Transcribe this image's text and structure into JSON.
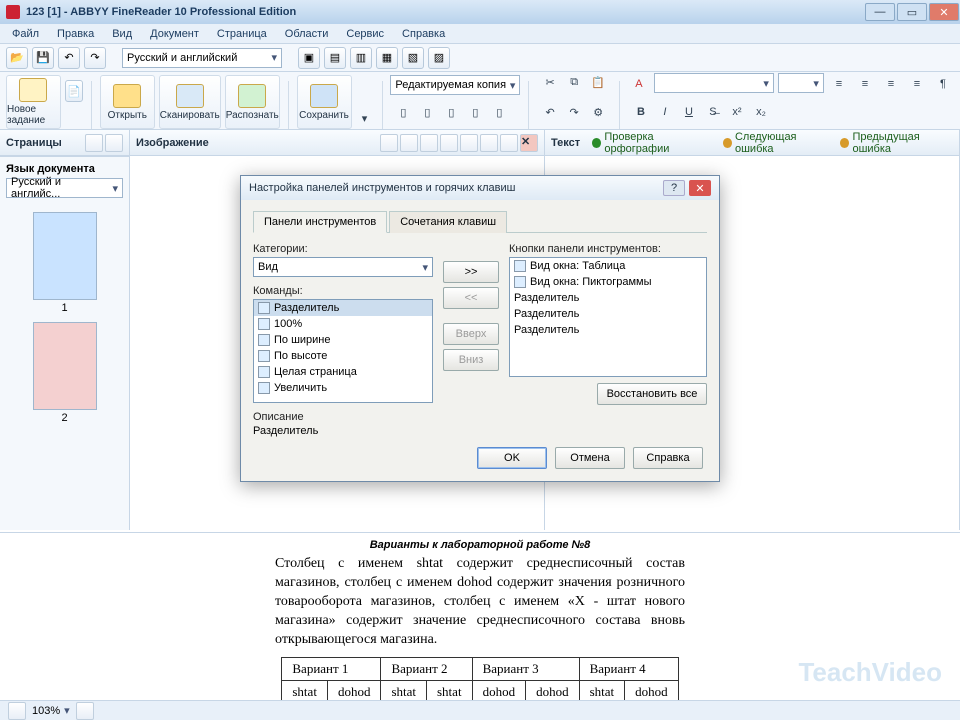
{
  "window": {
    "title": "123 [1] - ABBYY FineReader 10 Professional Edition"
  },
  "menu": [
    "Файл",
    "Правка",
    "Вид",
    "Документ",
    "Страница",
    "Области",
    "Сервис",
    "Справка"
  ],
  "toolbar": {
    "lang_selector": "Русский и английский"
  },
  "ribbon": {
    "new_task": "Новое задание",
    "open": "Открыть",
    "scan": "Сканировать",
    "recognize": "Распознать",
    "save": "Сохранить",
    "edit_mode": "Редактируемая копия"
  },
  "side": {
    "pages_title": "Страницы",
    "doc_lang_title": "Язык документа",
    "doc_lang_value": "Русский и английс...",
    "thumb1": "1",
    "thumb2": "2"
  },
  "panes": {
    "image": "Изображение",
    "text": "Текст",
    "spell": "Проверка орфографии",
    "next_err": "Следующая ошибка",
    "prev_err": "Предыдущая ошибка"
  },
  "dialog": {
    "title": "Настройка панелей инструментов и горячих клавиш",
    "tab_toolbars": "Панели инструментов",
    "tab_shortcuts": "Сочетания клавиш",
    "categories_label": "Категории:",
    "category_value": "Вид",
    "commands_label": "Команды:",
    "commands": [
      "Разделитель",
      "100%",
      "По ширине",
      "По высоте",
      "Целая страница",
      "Увеличить"
    ],
    "toolbar_buttons_label": "Кнопки панели инструментов:",
    "toolbar_buttons": [
      "Вид окна: Таблица",
      "Вид окна: Пиктограммы",
      "Разделитель",
      "Разделитель",
      "Разделитель"
    ],
    "btn_add": ">>",
    "btn_remove": "<<",
    "btn_up": "Вверх",
    "btn_down": "Вниз",
    "desc_label": "Описание",
    "desc_value": "Разделитель",
    "restore": "Восстановить все",
    "ok": "OK",
    "cancel": "Отмена",
    "help": "Справка"
  },
  "doc": {
    "title": "Варианты к лабораторной работе №8",
    "paragraph": "Столбец с именем shtat содержит среднесписочный состав магазинов, столбец с именем dohod содержит значения розничного товарооборота магазинов, столбец с именем «X - штат нового магазина» содержит значение среднесписочного состава вновь открывающегося магазина.",
    "table": {
      "headers": [
        "Вариант 1",
        "Вариант 2",
        "Вариант 3",
        "Вариант 4"
      ],
      "row": [
        "shtat",
        "dohod",
        "shtat",
        "shtat",
        "dohod",
        "dohod",
        "shtat",
        "dohod"
      ]
    }
  },
  "status": {
    "zoom1": "103%",
    "zoom2": "103%"
  },
  "watermark": "TeachVideo"
}
